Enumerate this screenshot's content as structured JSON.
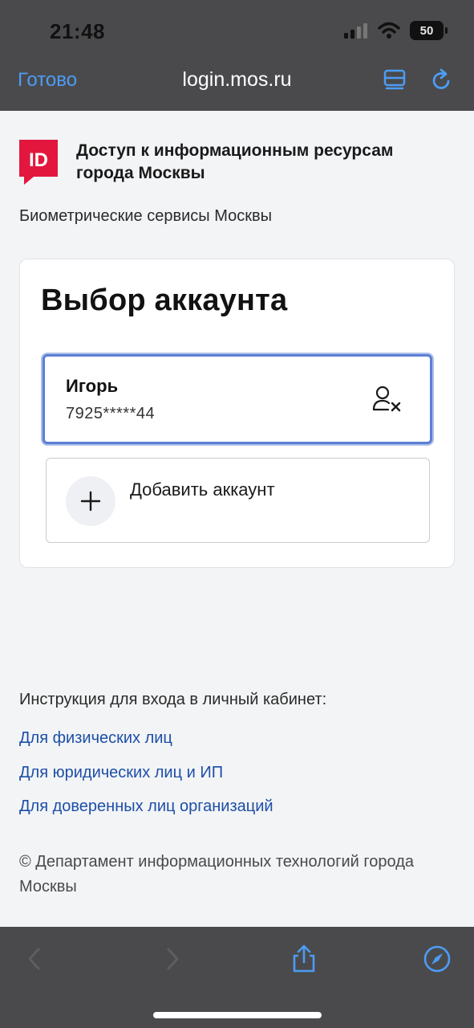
{
  "status_bar": {
    "time": "21:48",
    "battery": "50",
    "icons": [
      "signal-icon",
      "wifi-icon",
      "battery-icon"
    ]
  },
  "browser": {
    "done_label": "Готово",
    "url": "login.mos.ru",
    "icons": [
      "reader-icon",
      "reload-icon"
    ],
    "accent_color": "#4d9cf5"
  },
  "header": {
    "logo_text": "ID",
    "logo_color": "#e3173e",
    "title": "Доступ к информационным ресурсам города Москвы",
    "subtitle": "Биометрические сервисы Москвы"
  },
  "account_chooser": {
    "title": "Выбор аккаунта",
    "accounts": [
      {
        "name": "Игорь",
        "phone": "7925*****44"
      }
    ],
    "add_account_label": "Добавить аккаунт",
    "selected_border_color": "#5b7fd4"
  },
  "instructions": {
    "label": "Инструкция для входа в личный кабинет:",
    "links": [
      "Для физических лиц",
      "Для юридических лиц и ИП",
      "Для доверенных лиц организаций"
    ],
    "link_color": "#1d4fa7"
  },
  "footer": {
    "copyright": "© Департамент информационных технологий города Москвы"
  },
  "toolbar": {
    "icons": [
      "back-icon",
      "forward-icon",
      "share-icon",
      "safari-compass-icon"
    ]
  }
}
